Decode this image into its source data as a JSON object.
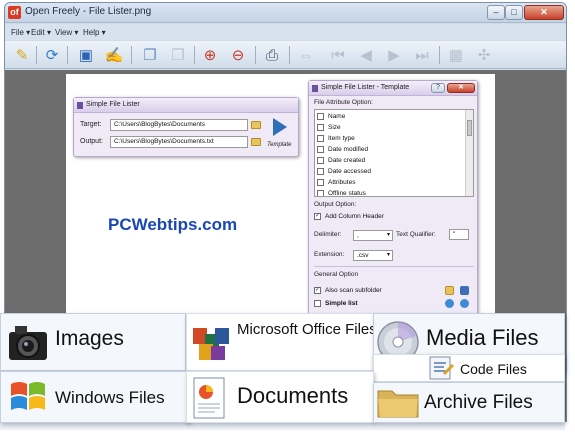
{
  "window": {
    "title": "Open Freely - File Lister.png",
    "app_badge": "of"
  },
  "window_buttons": {
    "minimize": "–",
    "maximize": "□",
    "close": "✕"
  },
  "menu": [
    "File ▾",
    "Edit ▾",
    "View ▾",
    "Help ▾"
  ],
  "toolbar_icons": [
    "open-icon",
    "refresh-icon",
    "save-icon",
    "save-as-icon",
    "copy-icon",
    "paste-icon",
    "zoom-in-icon",
    "zoom-out-icon",
    "print-icon",
    "fit-icon",
    "first-icon",
    "previous-icon",
    "next-icon",
    "last-icon",
    "grid-icon",
    "nav-icon"
  ],
  "lister": {
    "title": "Simple File Lister",
    "target_label": "Target:",
    "target_value": "C:\\Users\\BlogBytes\\Documents",
    "output_label": "Output:",
    "output_value": "C:\\Users\\BlogBytes\\Documents.txt",
    "template_label": "Template"
  },
  "template_dialog": {
    "title": "Simple File Lister - Template",
    "attr_group": "File Attribute Option:",
    "attributes": [
      "Name",
      "Size",
      "Item type",
      "Date modified",
      "Date created",
      "Date accessed",
      "Attributes",
      "Offline status"
    ],
    "output_group": "Output Option:",
    "add_column_header": "Add Column Header",
    "delimiter_label": "Delimiter:",
    "delimiter_value": ",",
    "text_qualifier_label": "Text Qualifier:",
    "text_qualifier_value": "\"",
    "extension_label": "Extension:",
    "extension_value": ".csv",
    "general_group": "General Option",
    "also_scan": "Also scan subfolder",
    "simple_list": "Simple list"
  },
  "watermark": "PCWebtips.com",
  "banner": {
    "images": "Images",
    "office": "Microsoft Office Files",
    "media": "Media Files",
    "code": "Code Files",
    "windows": "Windows Files",
    "documents": "Documents",
    "archive": "Archive Files"
  },
  "colors": {
    "watermark": "#1a47b8",
    "close_button": "#c7412b",
    "dialog_border": "#b6a7cf"
  }
}
